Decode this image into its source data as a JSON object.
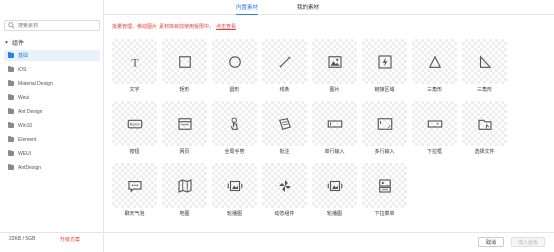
{
  "tabs": [
    {
      "label": "内置素材",
      "active": true
    },
    {
      "label": "我的素材",
      "active": false
    }
  ],
  "search": {
    "placeholder": "搜索素材"
  },
  "sidebar": {
    "group_title": "组件",
    "items": [
      {
        "label": "基础",
        "active": true
      },
      {
        "label": "iOS"
      },
      {
        "label": "Material Design"
      },
      {
        "label": "Weui"
      },
      {
        "label": "Ant Design"
      },
      {
        "label": "Win10"
      },
      {
        "label": "Element"
      },
      {
        "label": "WEUI"
      },
      {
        "label": "AntDesign"
      }
    ]
  },
  "notice": {
    "part1": "批量管理、移动图片",
    "part2": "素材库目前使用受限中，",
    "link": "点击查看"
  },
  "tiles": [
    {
      "label": "文字",
      "icon": "text-icon"
    },
    {
      "label": "矩形",
      "icon": "rectangle-icon"
    },
    {
      "label": "圆形",
      "icon": "circle-icon"
    },
    {
      "label": "线条",
      "icon": "line-icon"
    },
    {
      "label": "图片",
      "icon": "image-icon"
    },
    {
      "label": "链接区域",
      "icon": "lightning-link-icon"
    },
    {
      "label": "三角形",
      "icon": "triangle-icon"
    },
    {
      "label": "三角形",
      "icon": "right-triangle-icon"
    },
    {
      "label": "按钮",
      "icon": "button-icon"
    },
    {
      "label": "网页",
      "icon": "webpage-icon"
    },
    {
      "label": "全局手势",
      "icon": "gesture-icon"
    },
    {
      "label": "批注",
      "icon": "note-icon"
    },
    {
      "label": "单行输入",
      "icon": "single-input-icon"
    },
    {
      "label": "多行输入",
      "icon": "multi-input-icon"
    },
    {
      "label": "下拉框",
      "icon": "dropdown-icon"
    },
    {
      "label": "选择文件",
      "icon": "folder-select-icon"
    },
    {
      "label": "聊天气泡",
      "icon": "chat-bubble-icon"
    },
    {
      "label": "地图",
      "icon": "map-icon"
    },
    {
      "label": "轮播图",
      "icon": "carousel-icon"
    },
    {
      "label": "动态组件",
      "icon": "pinwheel-icon"
    },
    {
      "label": "轮播图",
      "icon": "carousel-icon"
    },
    {
      "label": "下拉菜单",
      "icon": "dropdown-menu-icon"
    }
  ],
  "footer": {
    "storage": "22KB / 5GB",
    "upgrade": "升级方案",
    "cancel": "取消",
    "insert": "插入画板"
  },
  "colors": {
    "accent": "#2b7de9",
    "warning": "#e2403a",
    "folder": "#8a8a8a"
  }
}
